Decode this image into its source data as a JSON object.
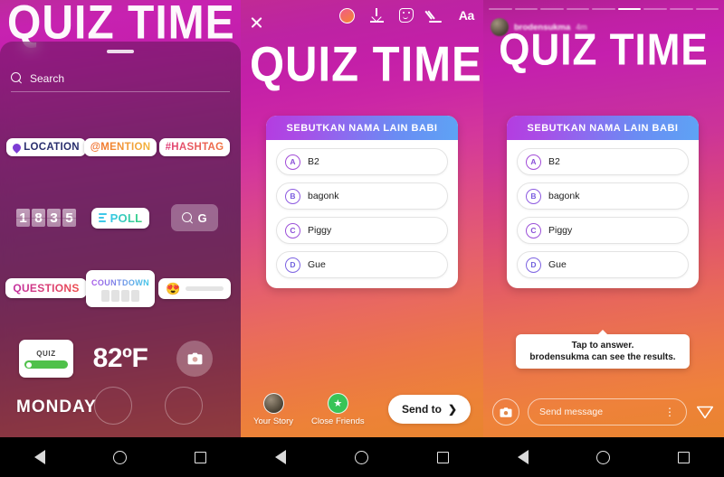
{
  "panel1": {
    "name": "sticker-tray-screen",
    "background_text": "QUIZ TIME",
    "search": {
      "placeholder": "Search",
      "icon": "search-icon"
    },
    "stickers": {
      "row1": [
        {
          "id": "location",
          "label": "LOCATION",
          "icon": "location-pin-icon"
        },
        {
          "id": "mention",
          "label": "@MENTION"
        },
        {
          "id": "hashtag",
          "label": "#HASHTAG"
        }
      ],
      "row2": [
        {
          "id": "time",
          "label": "1835",
          "digits": [
            "1",
            "8",
            "3",
            "5"
          ]
        },
        {
          "id": "poll",
          "label": "POLL",
          "icon": "poll-bars-icon"
        },
        {
          "id": "gif",
          "label": "G",
          "icon": "search-icon"
        }
      ],
      "row3": [
        {
          "id": "questions",
          "label": "QUESTIONS"
        },
        {
          "id": "countdown",
          "label": "COUNTDOWN"
        },
        {
          "id": "emoji-slider",
          "label": "",
          "emoji": "😍"
        }
      ],
      "row4": [
        {
          "id": "quiz",
          "label": "QUIZ"
        },
        {
          "id": "temperature",
          "label": "82ºF"
        },
        {
          "id": "camera-roll",
          "label": "",
          "icon": "camera-icon"
        }
      ],
      "row5": [
        {
          "id": "weekday",
          "label": "MONDAY"
        }
      ]
    }
  },
  "panel2": {
    "name": "story-editor-screen",
    "toolbar": {
      "close_label": "",
      "close_icon": "close-icon",
      "items": [
        {
          "id": "color",
          "icon": "color-circle-icon"
        },
        {
          "id": "save",
          "icon": "download-icon"
        },
        {
          "id": "sticker",
          "icon": "sticker-face-icon"
        },
        {
          "id": "draw",
          "icon": "pen-icon"
        },
        {
          "id": "text",
          "icon": "text-aa-icon",
          "label": "Aa"
        }
      ]
    },
    "title": "QUIZ TIME",
    "quiz": {
      "question": "SEBUTKAN NAMA LAIN BABI",
      "options": [
        {
          "key": "A",
          "text": "B2"
        },
        {
          "key": "B",
          "text": "bagonk"
        },
        {
          "key": "C",
          "text": "Piggy"
        },
        {
          "key": "D",
          "text": "Gue"
        }
      ]
    },
    "footer": {
      "your_story": "Your Story",
      "close_friends": "Close Friends",
      "send_to": "Send to",
      "send_chevron": "❯"
    }
  },
  "panel3": {
    "name": "story-viewer-screen",
    "header": {
      "username": "brodensukma",
      "timestamp": "4m"
    },
    "progress": {
      "segments": 9,
      "active_index": 5
    },
    "title": "QUIZ TIME",
    "quiz": {
      "question": "SEBUTKAN NAMA LAIN BABI",
      "options": [
        {
          "key": "A",
          "text": "B2"
        },
        {
          "key": "B",
          "text": "bagonk"
        },
        {
          "key": "C",
          "text": "Piggy"
        },
        {
          "key": "D",
          "text": "Gue"
        }
      ]
    },
    "tooltip": {
      "line1": "Tap to answer.",
      "line2": "brodensukma can see the results."
    },
    "footer": {
      "camera_icon": "camera-icon",
      "message_placeholder": "Send message",
      "more_icon": "more-vertical-icon",
      "send_icon": "direct-send-icon"
    }
  },
  "navbar": {
    "back": "back-triangle-icon",
    "home": "home-circle-icon",
    "recents": "recents-square-icon"
  },
  "colors": {
    "quiz_header_start": "#b43ce0",
    "quiz_header_end": "#5ea3f5",
    "close_friends_green": "#38c457",
    "poll_green": "#39d07e",
    "quiz_answer_green": "#4fc14a"
  }
}
